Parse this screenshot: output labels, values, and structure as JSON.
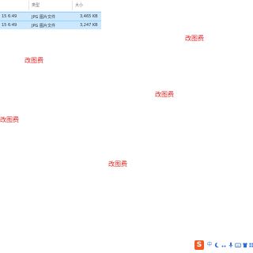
{
  "file_list": {
    "columns": {
      "type": "类型",
      "size": "大小"
    },
    "rows": [
      {
        "date": "15 6:49",
        "type": "JPG 图片文件",
        "size": "3,465 KB",
        "selected": true
      },
      {
        "date": "15 6:49",
        "type": "JPG 图片文件",
        "size": "3,247 KB",
        "selected": true
      }
    ]
  },
  "watermarks": [
    "改图费",
    "改图费",
    "改图费",
    "改图费",
    "改图费"
  ],
  "taskbar": {
    "ime_logo": "S",
    "ime_mode": "中",
    "icons": [
      "sogou-ime-icon",
      "chinese-mode-icon",
      "moon-icon",
      "punctuation-icon",
      "microphone-icon",
      "keyboard-icon",
      "skin-icon",
      "toolbox-icon"
    ]
  },
  "colors": {
    "selection": "#cce8ff",
    "watermark": "#e02020",
    "ime_brand": "#f25a24",
    "tray_icons": "#2b6fd6"
  }
}
